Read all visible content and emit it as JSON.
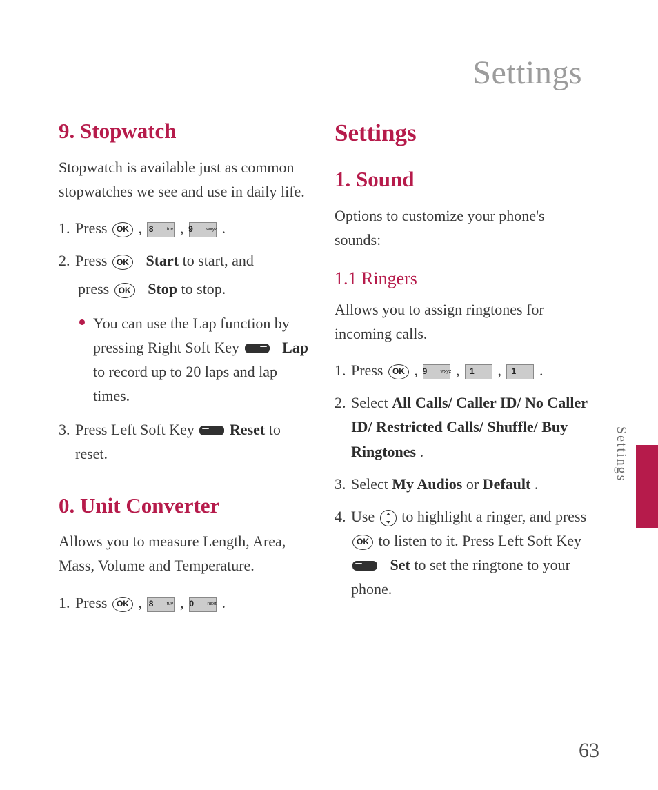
{
  "page": {
    "title": "Settings",
    "side_label": "Settings",
    "number": "63"
  },
  "keys": {
    "ok": "OK",
    "d8": {
      "n": "8",
      "s": "tuv"
    },
    "d9": {
      "n": "9",
      "s": "wxyz"
    },
    "d0": {
      "n": "0",
      "s": "next"
    },
    "d1": {
      "n": "1",
      "s": ""
    }
  },
  "left": {
    "stopwatch": {
      "heading": "9. Stopwatch",
      "intro": "Stopwatch is available just as common stopwatches we see and use in daily life.",
      "s1": {
        "n": "1.",
        "a": "Press ",
        "c1": " , ",
        "c2": " , ",
        "end": " ."
      },
      "s2": {
        "n": "2.",
        "a": "Press ",
        "start": "Start",
        "b": " to start, and",
        "c": "press ",
        "stop": "Stop",
        "d": " to stop."
      },
      "bullet": {
        "a": "You can use the Lap function by pressing Right Soft Key ",
        "lap": "Lap",
        "b": " to record up to 20 laps and lap times."
      },
      "s3": {
        "n": "3.",
        "a": "Press Left Soft Key ",
        "reset": "Reset",
        "b": " to reset."
      }
    },
    "unit": {
      "heading": "0. Unit Converter",
      "intro": "Allows you to measure Length, Area, Mass, Volume and Temperature.",
      "s1": {
        "n": "1.",
        "a": "Press ",
        "c1": " , ",
        "c2": " , ",
        "end": " ."
      }
    }
  },
  "right": {
    "settings_heading": "Settings",
    "sound": {
      "heading": "1. Sound",
      "intro": "Options to customize your phone's sounds:"
    },
    "ringers": {
      "heading": "1.1 Ringers",
      "intro": "Allows you to assign ringtones for incoming calls.",
      "s1": {
        "n": "1.",
        "a": "Press ",
        "c": " , ",
        "end": " ."
      },
      "s2": {
        "n": "2.",
        "a": "Select ",
        "opts": "All Calls/ Caller ID/ No Caller ID/ Restricted Calls/ Shuffle/ Buy Ringtones",
        "end": "."
      },
      "s3": {
        "n": "3.",
        "a": "Select ",
        "o1": "My Audios",
        "or": " or ",
        "o2": "Default",
        "end": "."
      },
      "s4": {
        "n": "4.",
        "a": "Use ",
        "b": " to highlight a ringer, and press ",
        "c": " to listen to it. Press Left Soft Key ",
        "set": "Set",
        "d": " to set the ringtone to your phone."
      }
    }
  }
}
